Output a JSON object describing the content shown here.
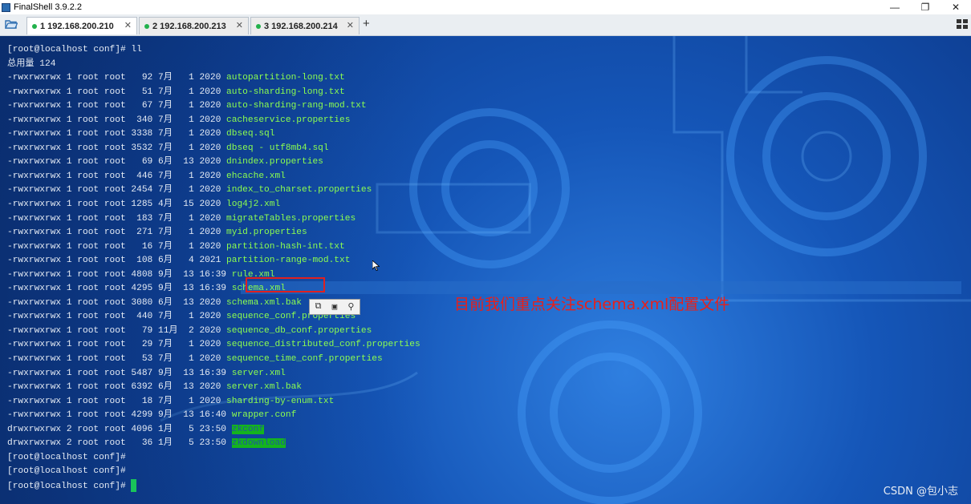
{
  "window": {
    "title": "FinalShell 3.9.2.2",
    "minimize": "—",
    "maximize": "❐",
    "close": "✕"
  },
  "tabs": [
    {
      "label": "1 192.168.200.210",
      "close": "✕",
      "active": true
    },
    {
      "label": "2 192.168.200.213",
      "close": "✕",
      "active": false
    },
    {
      "label": "3 192.168.200.214",
      "close": "✕",
      "active": false
    }
  ],
  "tab_add": "+",
  "terminal": {
    "command_line": "[root@localhost conf]# ll",
    "total_line": "总用量 124",
    "files": [
      {
        "meta": "-rwxrwxrwx 1 root root   92 7月   1 2020 ",
        "name": "autopartition-long.txt"
      },
      {
        "meta": "-rwxrwxrwx 1 root root   51 7月   1 2020 ",
        "name": "auto-sharding-long.txt"
      },
      {
        "meta": "-rwxrwxrwx 1 root root   67 7月   1 2020 ",
        "name": "auto-sharding-rang-mod.txt"
      },
      {
        "meta": "-rwxrwxrwx 1 root root  340 7月   1 2020 ",
        "name": "cacheservice.properties"
      },
      {
        "meta": "-rwxrwxrwx 1 root root 3338 7月   1 2020 ",
        "name": "dbseq.sql"
      },
      {
        "meta": "-rwxrwxrwx 1 root root 3532 7月   1 2020 ",
        "name": "dbseq - utf8mb4.sql"
      },
      {
        "meta": "-rwxrwxrwx 1 root root   69 6月  13 2020 ",
        "name": "dnindex.properties"
      },
      {
        "meta": "-rwxrwxrwx 1 root root  446 7月   1 2020 ",
        "name": "ehcache.xml"
      },
      {
        "meta": "-rwxrwxrwx 1 root root 2454 7月   1 2020 ",
        "name": "index_to_charset.properties"
      },
      {
        "meta": "-rwxrwxrwx 1 root root 1285 4月  15 2020 ",
        "name": "log4j2.xml"
      },
      {
        "meta": "-rwxrwxrwx 1 root root  183 7月   1 2020 ",
        "name": "migrateTables.properties"
      },
      {
        "meta": "-rwxrwxrwx 1 root root  271 7月   1 2020 ",
        "name": "myid.properties"
      },
      {
        "meta": "-rwxrwxrwx 1 root root   16 7月   1 2020 ",
        "name": "partition-hash-int.txt"
      },
      {
        "meta": "-rwxrwxrwx 1 root root  108 6月   4 2021 ",
        "name": "partition-range-mod.txt"
      },
      {
        "meta": "-rwxrwxrwx 1 root root 4808 9月  13 16:39 ",
        "name": "rule.xml"
      },
      {
        "meta": "-rwxrwxrwx 1 root root 4295 9月  13 16:39 ",
        "name": "schema.xml"
      },
      {
        "meta": "-rwxrwxrwx 1 root root 3080 6月  13 2020 ",
        "name": "schema.xml.bak"
      },
      {
        "meta": "-rwxrwxrwx 1 root root  440 7月   1 2020 ",
        "name": "sequence_conf.properties"
      },
      {
        "meta": "-rwxrwxrwx 1 root root   79 11月  2 2020 ",
        "name": "sequence_db_conf.properties"
      },
      {
        "meta": "-rwxrwxrwx 1 root root   29 7月   1 2020 ",
        "name": "sequence_distributed_conf.properties"
      },
      {
        "meta": "-rwxrwxrwx 1 root root   53 7月   1 2020 ",
        "name": "sequence_time_conf.properties"
      },
      {
        "meta": "-rwxrwxrwx 1 root root 5487 9月  13 16:39 ",
        "name": "server.xml"
      },
      {
        "meta": "-rwxrwxrwx 1 root root 6392 6月  13 2020 ",
        "name": "server.xml.bak"
      },
      {
        "meta": "-rwxrwxrwx 1 root root   18 7月   1 2020 ",
        "name": "sharding-by-enum.txt"
      },
      {
        "meta": "-rwxrwxrwx 1 root root 4299 9月  13 16:40 ",
        "name": "wrapper.conf"
      }
    ],
    "dirs": [
      {
        "meta": "drwxrwxrwx 2 root root 4096 1月   5 23:50 ",
        "name": "zkconf"
      },
      {
        "meta": "drwxrwxrwx 2 root root   36 1月   5 23:50 ",
        "name": "zkdownload"
      }
    ],
    "prompts": [
      "[root@localhost conf]#",
      "[root@localhost conf]#",
      "[root@localhost conf]# "
    ]
  },
  "annotation": "目前我们重点关注schema.xml配置文件",
  "watermark": "CSDN @包小志",
  "colors": {
    "terminal_bg": "#1556b8",
    "filename": "#8cff4f",
    "directory_bg": "#14b41e",
    "annotation": "#e8201a",
    "highlight_box": "#e02020",
    "tab_dot": "#22b14c"
  }
}
